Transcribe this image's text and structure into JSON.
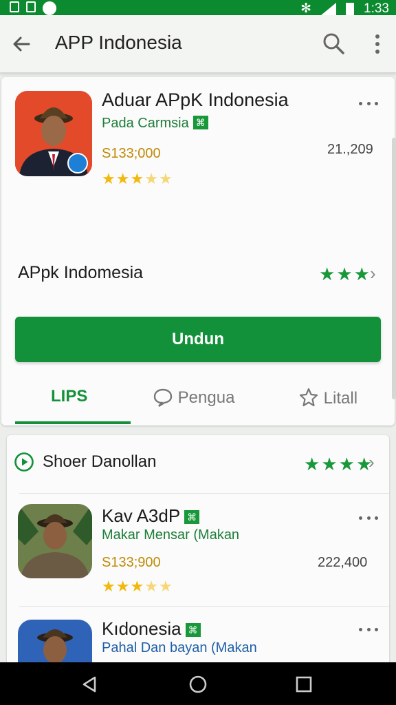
{
  "status_bar": {
    "time": "1:33"
  },
  "app_bar": {
    "title": "APP Indonesia"
  },
  "featured": {
    "name": "Aduar APpK Indonesia",
    "developer": "Pada Carmsia",
    "price": "S133;000",
    "count": "21.,209",
    "rating": 3.5,
    "sub_label": "APpk Indomesia",
    "sub_rating": 3,
    "install_label": "Undun"
  },
  "tabs": [
    {
      "label": "LIPS",
      "active": true
    },
    {
      "label": "Pengua",
      "active": false
    },
    {
      "label": "Litall",
      "active": false
    }
  ],
  "section": {
    "title": "Shoer Danollan",
    "rating": 4
  },
  "list": [
    {
      "name": "Kav A3dP",
      "developer": "Makar Mensar (Makan",
      "price": "S133;900",
      "count": "222,400",
      "rating": 3.5
    },
    {
      "name": "Kıdonesia",
      "developer": "Pahal Dan bayan (Makan"
    }
  ],
  "colors": {
    "brand_green": "#13913a",
    "status_green": "#0b8a2f",
    "star_gold": "#f3b80c"
  }
}
